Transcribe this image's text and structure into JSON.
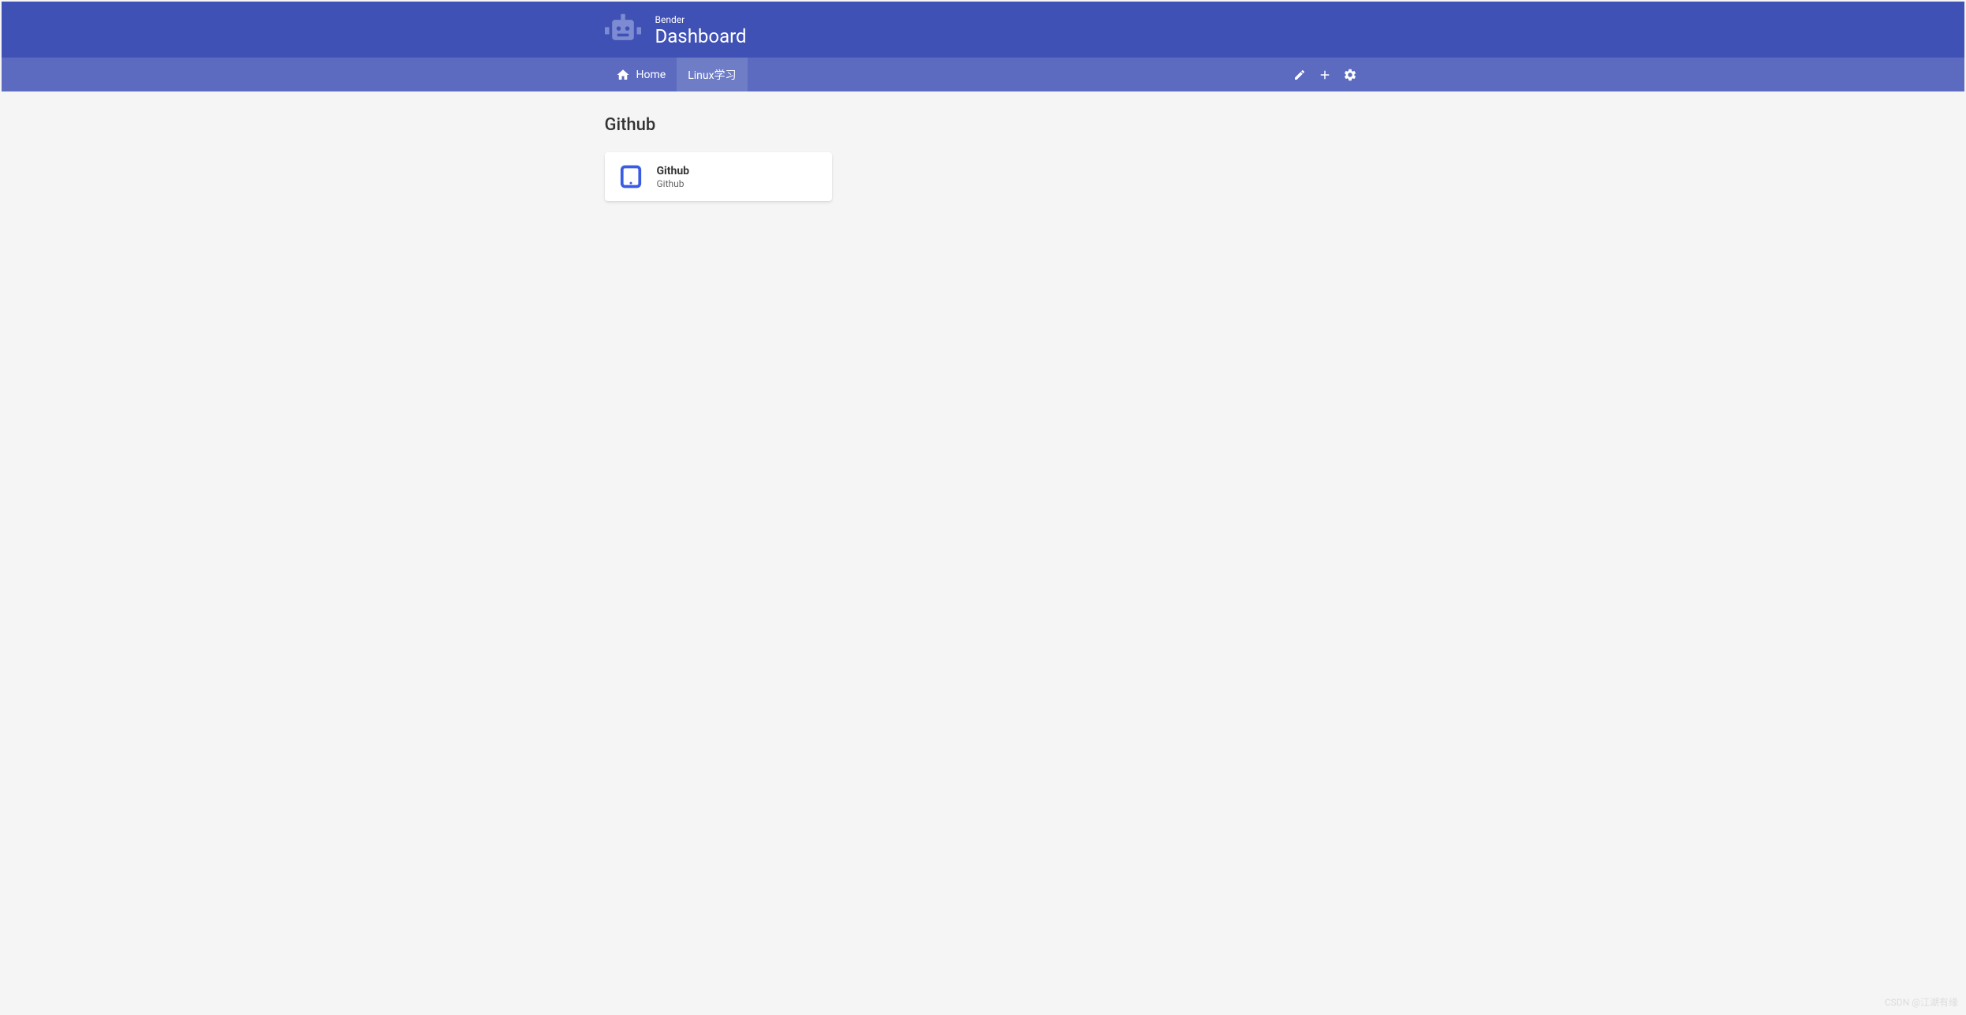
{
  "header": {
    "subtitle": "Bender",
    "title": "Dashboard"
  },
  "nav": {
    "tabs": [
      {
        "label": "Home",
        "icon": "home-icon"
      },
      {
        "label": "Linux学习",
        "icon": null
      }
    ],
    "active_tab_index": 1
  },
  "section": {
    "title": "Github",
    "cards": [
      {
        "title": "Github",
        "subtitle": "Github",
        "icon": "tablet-icon"
      }
    ]
  },
  "watermark": "CSDN @江湖有缘"
}
